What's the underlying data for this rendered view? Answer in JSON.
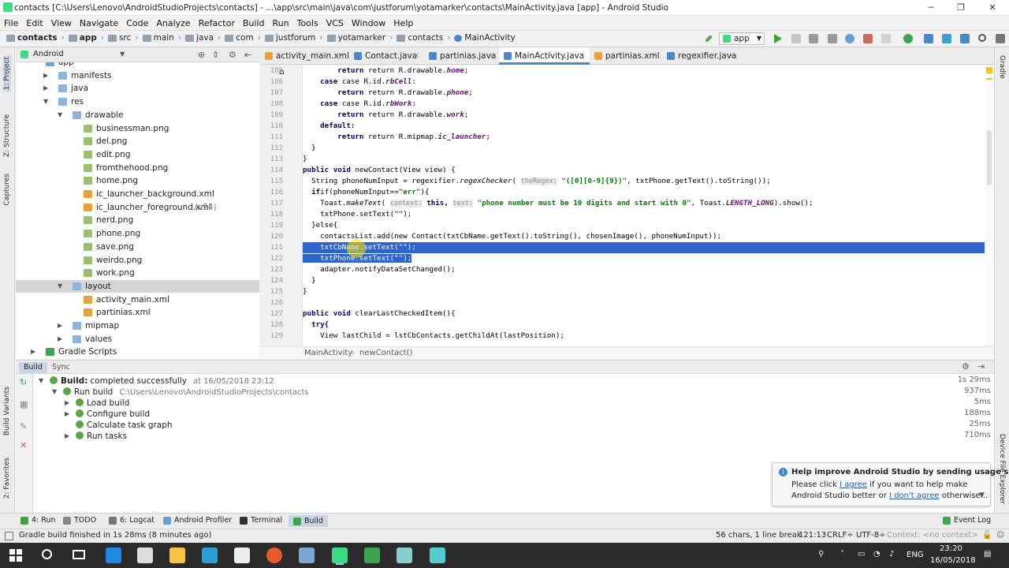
{
  "window": {
    "title": "contacts [C:\\Users\\Lenovo\\AndroidStudioProjects\\contacts] - ...\\app\\src\\main\\java\\com\\justforum\\yotamarker\\contacts\\MainActivity.java [app] - Android Studio",
    "minimize": "─",
    "maximize": "❐",
    "close": "✕"
  },
  "menu": [
    "File",
    "Edit",
    "View",
    "Navigate",
    "Code",
    "Analyze",
    "Refactor",
    "Build",
    "Run",
    "Tools",
    "VCS",
    "Window",
    "Help"
  ],
  "nav": {
    "crumbs": [
      "contacts",
      "app",
      "src",
      "main",
      "java",
      "com",
      "justforum",
      "yotamarker",
      "contacts",
      "MainActivity"
    ],
    "config": "app"
  },
  "left_stripe": {
    "project": "1: Project",
    "structure": "Z: Structure",
    "captures": "Captures",
    "build_variants": "Build Variants",
    "favorites": "2: Favorites"
  },
  "right_stripe": {
    "gradle": "Gradle",
    "device": "Device File Explorer"
  },
  "project": {
    "view": "Android",
    "tree": [
      {
        "label": "app",
        "indent": 0,
        "arrow": "",
        "color": "#6aa5d8"
      },
      {
        "label": "manifests",
        "indent": 1,
        "arrow": "▶",
        "color": "#8fb3d9"
      },
      {
        "label": "java",
        "indent": 1,
        "arrow": "▶",
        "color": "#8fb3d9"
      },
      {
        "label": "res",
        "indent": 1,
        "arrow": "▼",
        "color": "#8fb3d9"
      },
      {
        "label": "drawable",
        "indent": 2,
        "arrow": "▼",
        "color": "#8fb3d9"
      },
      {
        "label": "businessman.png",
        "indent": 3,
        "arrow": "",
        "color": "#9cbf6b"
      },
      {
        "label": "del.png",
        "indent": 3,
        "arrow": "",
        "color": "#9cbf6b"
      },
      {
        "label": "edit.png",
        "indent": 3,
        "arrow": "",
        "color": "#9cbf6b"
      },
      {
        "label": "fromthehood.png",
        "indent": 3,
        "arrow": "",
        "color": "#9cbf6b"
      },
      {
        "label": "home.png",
        "indent": 3,
        "arrow": "",
        "color": "#9cbf6b"
      },
      {
        "label": "ic_launcher_background.xml",
        "indent": 3,
        "arrow": "",
        "color": "#e6a23c"
      },
      {
        "label": "ic_launcher_foreground.xml",
        "indent": 3,
        "arrow": "",
        "color": "#e6a23c",
        "suffix": "(v24)"
      },
      {
        "label": "nerd.png",
        "indent": 3,
        "arrow": "",
        "color": "#9cbf6b"
      },
      {
        "label": "phone.png",
        "indent": 3,
        "arrow": "",
        "color": "#9cbf6b"
      },
      {
        "label": "save.png",
        "indent": 3,
        "arrow": "",
        "color": "#9cbf6b"
      },
      {
        "label": "weirdo.png",
        "indent": 3,
        "arrow": "",
        "color": "#9cbf6b"
      },
      {
        "label": "work.png",
        "indent": 3,
        "arrow": "",
        "color": "#9cbf6b"
      },
      {
        "label": "layout",
        "indent": 2,
        "arrow": "▼",
        "color": "#8fb3d9",
        "selected": true
      },
      {
        "label": "activity_main.xml",
        "indent": 3,
        "arrow": "",
        "color": "#e6a23c"
      },
      {
        "label": "partinias.xml",
        "indent": 3,
        "arrow": "",
        "color": "#e6a23c"
      },
      {
        "label": "mipmap",
        "indent": 2,
        "arrow": "▶",
        "color": "#8fb3d9"
      },
      {
        "label": "values",
        "indent": 2,
        "arrow": "▶",
        "color": "#8fb3d9"
      },
      {
        "label": "Gradle Scripts",
        "indent": 0,
        "arrow": "▶",
        "color": "#3ba54f"
      }
    ]
  },
  "tabs": [
    {
      "label": "activity_main.xml",
      "color": "#e6a23c"
    },
    {
      "label": "Contact.java",
      "color": "#4a88c7"
    },
    {
      "label": "partinias.java",
      "color": "#4a88c7"
    },
    {
      "label": "MainActivity.java",
      "color": "#4a88c7",
      "active": true
    },
    {
      "label": "partinias.xml",
      "color": "#e6a23c"
    },
    {
      "label": "regexifier.java",
      "color": "#4a88c7"
    }
  ],
  "editor": {
    "line_numbers": [
      "105",
      "106",
      "107",
      "108",
      "109",
      "110",
      "111",
      "112",
      "113",
      "114",
      "115",
      "116",
      "117",
      "118",
      "119",
      "120",
      "121",
      "122",
      "123",
      "124",
      "125",
      "126",
      "127",
      "128",
      "129"
    ],
    "lines": {
      "l105": "return R.drawable.",
      "l105f": "home",
      "l106a": "case R.id.",
      "l106f": "rbCell",
      "l107a": "return R.drawable.",
      "l107f": "phone",
      "l108a": "case R.id.",
      "l108f": "rbWork",
      "l109a": "return R.drawable.",
      "l109f": "work",
      "l110": "default:",
      "l111a": "return R.mipmap.",
      "l111f": "ic_launcher",
      "l114a": "public void ",
      "l114b": "newContact(View view) {",
      "l115a": "String phoneNumInput = regexifier.",
      "l115i": "regexChecker",
      "l115h": "theRegex:",
      "l115s": "\"([0][0-9]{9})\"",
      "l115b": ", txtPhone.getText().toString());",
      "l116a": "if(phoneNumInput==",
      "l116s": "\"err\"",
      "l116b": "){",
      "l117a": "Toast.",
      "l117i": "makeText",
      "l117h1": "context:",
      "l117b": "this, ",
      "l117h2": "text:",
      "l117s": "\"phone number must be 10 digits and start with 0\"",
      "l117c": ", Toast.",
      "l117f": "LENGTH_LONG",
      "l117d": ").show();",
      "l118a": "txtPhone.setText(",
      "l118s": "\"\"",
      "l118b": ");",
      "l119": "}else{",
      "l120": "contactsList.add(new Contact(txtCbName.getText().toString(), chosenImage(), phoneNumInput));",
      "l121": "txtCbName.setText(\"\");",
      "l122": "txtPhone.setText(\"\");",
      "l123": "adapter.notifyDataSetChanged();",
      "l127a": "public void ",
      "l127b": "clearLastCheckedItem(){",
      "l128": "try{",
      "l129": "View lastChild = lstCbContacts.getChildAt(lastPosition);"
    }
  },
  "editor_breadcrumb": [
    "MainActivity",
    "newContact()"
  ],
  "build": {
    "tab": "Build",
    "sync": "Sync",
    "rows": [
      {
        "text": "Build:",
        "text2": "completed successfully",
        "extra": "at 16/05/2018 23:12",
        "time": "1s 29ms"
      },
      {
        "text": "Run build",
        "extra": "C:\\Users\\Lenovo\\AndroidStudioProjects\\contacts",
        "time": "937ms"
      },
      {
        "text": "Load build",
        "time": "5ms"
      },
      {
        "text": "Configure build",
        "time": "188ms"
      },
      {
        "text": "Calculate task graph",
        "time": "25ms"
      },
      {
        "text": "Run tasks",
        "time": "710ms"
      }
    ]
  },
  "notification": {
    "title": "Help improve Android Studio by sending usage s",
    "p1": "Please click ",
    "agree": "I agree",
    "p2": " if you want to help make",
    "p3": "Android Studio better or ",
    "disagree": "I don't agree",
    "p4": " otherwise..."
  },
  "toolwindows": {
    "run": "4: Run",
    "todo": "TODO",
    "logcat": "6: Logcat",
    "profiler": "Android Profiler",
    "terminal": "Terminal",
    "build": "Build",
    "eventlog": "Event Log"
  },
  "status": {
    "message": "Gradle build finished in 1s 28ms (8 minutes ago)",
    "chars": "56 chars, 1 line break",
    "pos": "121:13",
    "crlf": "CRLF÷",
    "enc": "UTF-8÷",
    "context": "Context: <no context>"
  },
  "taskbar": {
    "lang": "ENG",
    "time": "23:20",
    "date": "16/05/2018"
  }
}
